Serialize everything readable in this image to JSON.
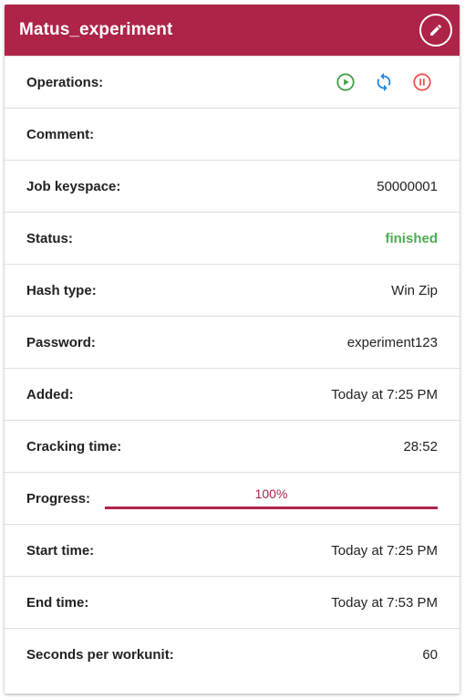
{
  "header": {
    "title": "Matus_experiment"
  },
  "rows": {
    "operations": {
      "label": "Operations:",
      "icons": [
        "play-circle-icon",
        "refresh-icon",
        "pause-circle-icon"
      ]
    },
    "comment": {
      "label": "Comment:",
      "value": ""
    },
    "keyspace": {
      "label": "Job keyspace:",
      "value": "50000001"
    },
    "status": {
      "label": "Status:",
      "value": "finished"
    },
    "hash_type": {
      "label": "Hash type:",
      "value": "Win Zip"
    },
    "password": {
      "label": "Password:",
      "value": "experiment123"
    },
    "added": {
      "label": "Added:",
      "value": "Today at 7:25 PM"
    },
    "cracking_time": {
      "label": "Cracking time:",
      "value": "28:52"
    },
    "progress": {
      "label": "Progress:",
      "text": "100%",
      "fraction": 1.0
    },
    "start_time": {
      "label": "Start time:",
      "value": "Today at 7:25 PM"
    },
    "end_time": {
      "label": "End time:",
      "value": "Today at 7:53 PM"
    },
    "seconds_per_workunit": {
      "label": "Seconds per workunit:",
      "value": "60"
    }
  },
  "colors": {
    "header": "#ad2448",
    "status_finished": "#4caf50",
    "play": "#43a047",
    "refresh": "#1e88e5",
    "pause": "#ef5350"
  }
}
